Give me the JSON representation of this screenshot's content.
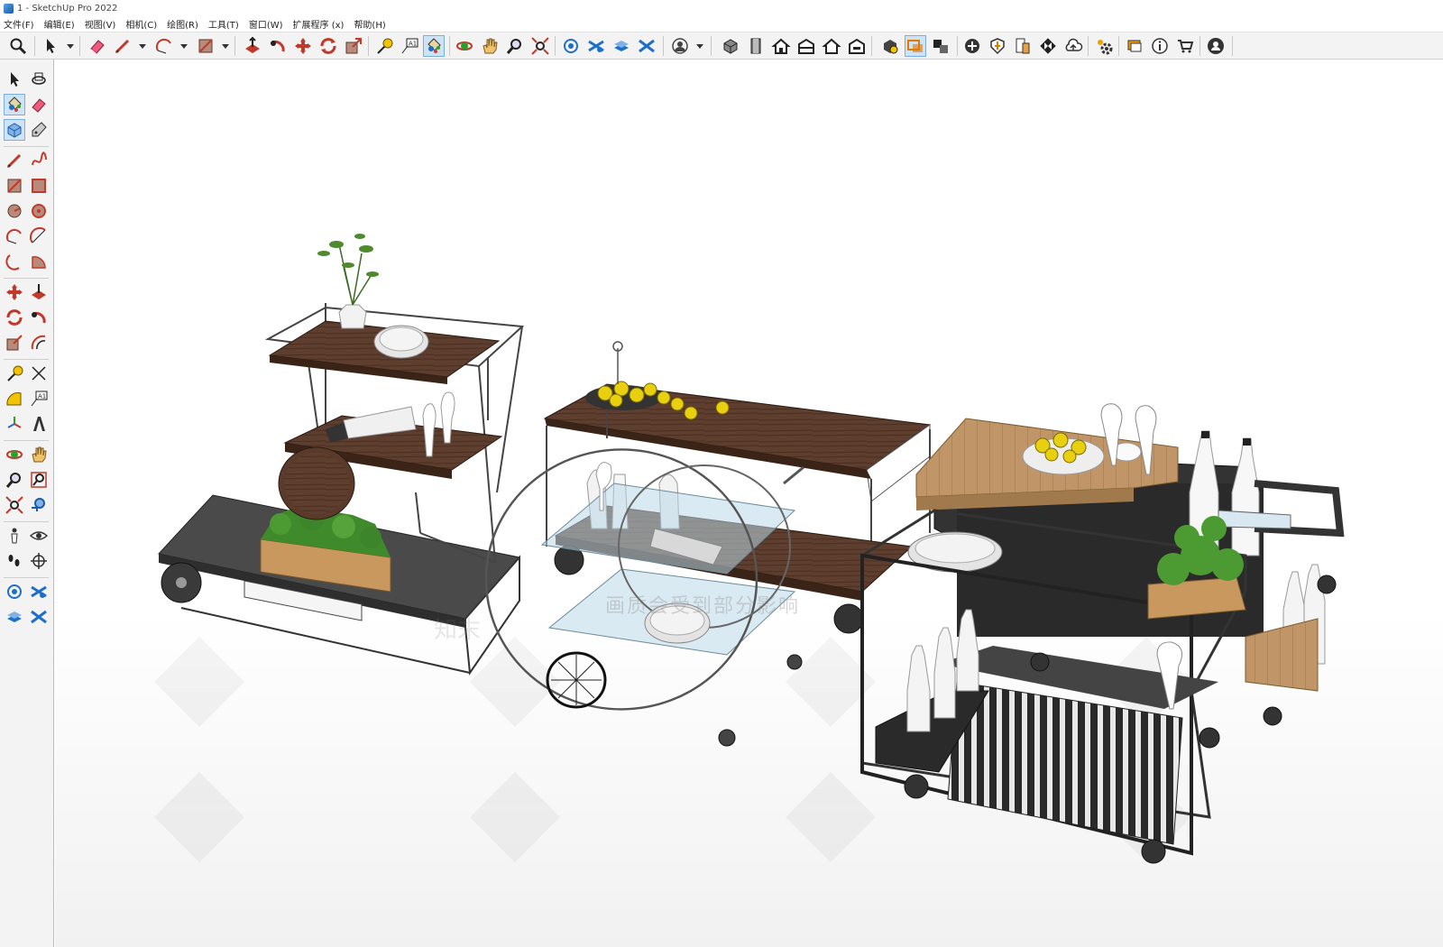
{
  "window": {
    "title": "1 - SketchUp Pro 2022"
  },
  "menu": {
    "items": [
      "文件(F)",
      "编辑(E)",
      "视图(V)",
      "相机(C)",
      "绘图(R)",
      "工具(T)",
      "窗口(W)",
      "扩展程序 (x)",
      "帮助(H)"
    ]
  },
  "toolbar": {
    "active_tools": [
      "paint-bucket-tool",
      "section-display-tool"
    ],
    "tools": [
      "zoom-icon",
      "select-icon",
      "eraser-icon",
      "pencil-icon",
      "arc-icon",
      "rectangle-icon",
      "push-pull-icon",
      "follow-me-icon",
      "move-icon",
      "rotate-icon",
      "scale-icon",
      "tape-measure-icon",
      "text-icon",
      "paint-bucket-icon",
      "orbit-icon",
      "pan-icon",
      "zoom-tool-icon",
      "zoom-extents-icon",
      "warehouse-icon",
      "extension-warehouse-icon",
      "layout-icon",
      "sandbox-icon",
      "user-icon",
      "iso-view-icon",
      "top-view-icon",
      "front-view-icon",
      "right-view-icon",
      "back-view-icon",
      "left-view-icon",
      "component-options-icon",
      "section-plane-icon",
      "section-cut-icon",
      "add-location-icon",
      "shadow-icon",
      "fog-icon",
      "styles-icon",
      "cloud-icon",
      "settings-icon",
      "chat-icon",
      "info-icon",
      "cart-icon",
      "account-icon"
    ]
  },
  "viewport": {
    "watermark": "画质会受到部分影响",
    "watermark_brand": "知末"
  }
}
